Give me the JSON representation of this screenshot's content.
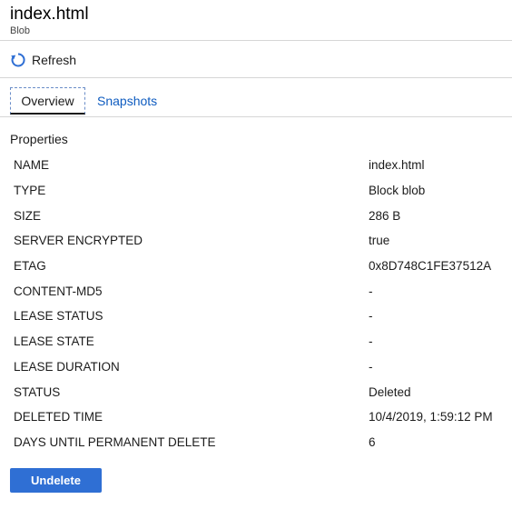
{
  "header": {
    "title": "index.html",
    "subtitle": "Blob"
  },
  "toolbar": {
    "refresh_label": "Refresh",
    "refresh_icon": "refresh-icon"
  },
  "tabs": [
    {
      "label": "Overview",
      "active": true
    },
    {
      "label": "Snapshots",
      "active": false
    }
  ],
  "properties": {
    "title": "Properties",
    "rows": [
      {
        "key": "NAME",
        "value": "index.html"
      },
      {
        "key": "TYPE",
        "value": "Block blob"
      },
      {
        "key": "SIZE",
        "value": "286 B"
      },
      {
        "key": "SERVER ENCRYPTED",
        "value": "true"
      },
      {
        "key": "ETAG",
        "value": "0x8D748C1FE37512A"
      },
      {
        "key": "CONTENT-MD5",
        "value": "-"
      },
      {
        "key": "LEASE STATUS",
        "value": "-"
      },
      {
        "key": "LEASE STATE",
        "value": "-"
      },
      {
        "key": "LEASE DURATION",
        "value": "-"
      },
      {
        "key": "STATUS",
        "value": "Deleted"
      },
      {
        "key": "DELETED TIME",
        "value": "10/4/2019, 1:59:12 PM"
      },
      {
        "key": "DAYS UNTIL PERMANENT DELETE",
        "value": "6"
      }
    ]
  },
  "actions": {
    "undelete_label": "Undelete"
  },
  "colors": {
    "accent": "#2f6fd4",
    "link": "#0f5cc0",
    "divider": "#d6d6d6"
  }
}
